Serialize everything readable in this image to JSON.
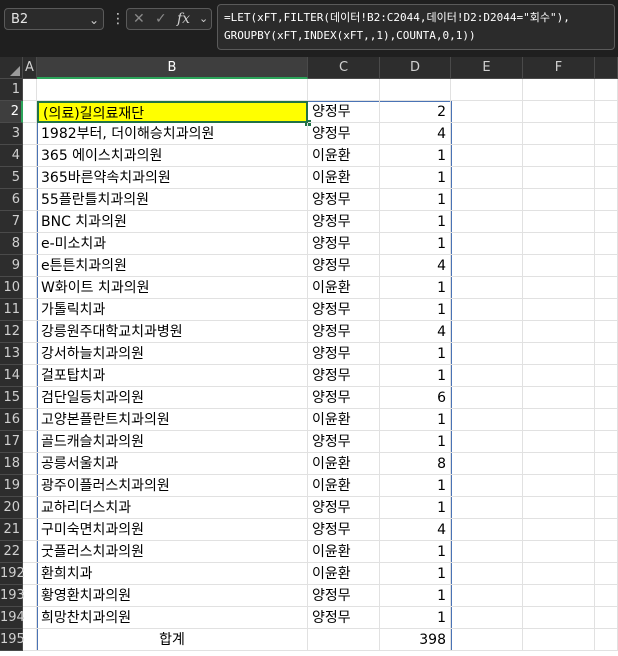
{
  "toolbar": {
    "name_box": "B2",
    "formula_line1": "=LET(xFT,FILTER(데이터!B2:C2044,데이터!D2:D2044=\"회수\"),",
    "formula_line2": "GROUPBY(xFT,INDEX(xFT,,1),COUNTA,0,1))"
  },
  "columns": [
    "A",
    "B",
    "C",
    "D",
    "E",
    "F"
  ],
  "rows": [
    {
      "num": "1",
      "b": "",
      "c": "",
      "d": ""
    },
    {
      "num": "2",
      "b": "(의료)길의료재단",
      "c": "양정무",
      "d": "2"
    },
    {
      "num": "3",
      "b": "1982부터, 더이해승치과의원",
      "c": "양정무",
      "d": "4"
    },
    {
      "num": "4",
      "b": "365 에이스치과의원",
      "c": "이윤환",
      "d": "1"
    },
    {
      "num": "5",
      "b": "365바른약속치과의원",
      "c": "이윤환",
      "d": "1"
    },
    {
      "num": "6",
      "b": "55플란틀치과의원",
      "c": "양정무",
      "d": "1"
    },
    {
      "num": "7",
      "b": "BNC 치과의원",
      "c": "양정무",
      "d": "1"
    },
    {
      "num": "8",
      "b": "e-미소치과",
      "c": "양정무",
      "d": "1"
    },
    {
      "num": "9",
      "b": "e튼튼치과의원",
      "c": "양정무",
      "d": "4"
    },
    {
      "num": "10",
      "b": "W화이트 치과의원",
      "c": "이윤환",
      "d": "1"
    },
    {
      "num": "11",
      "b": "가톨릭치과",
      "c": "양정무",
      "d": "1"
    },
    {
      "num": "12",
      "b": "강릉원주대학교치과병원",
      "c": "양정무",
      "d": "4"
    },
    {
      "num": "13",
      "b": "강서하늘치과의원",
      "c": "양정무",
      "d": "1"
    },
    {
      "num": "14",
      "b": "걸포탑치과",
      "c": "양정무",
      "d": "1"
    },
    {
      "num": "15",
      "b": "검단일등치과의원",
      "c": "양정무",
      "d": "6"
    },
    {
      "num": "16",
      "b": "고양본플란트치과의원",
      "c": "이윤환",
      "d": "1"
    },
    {
      "num": "17",
      "b": "골드캐슬치과의원",
      "c": "양정무",
      "d": "1"
    },
    {
      "num": "18",
      "b": "공릉서울치과",
      "c": "이윤환",
      "d": "8"
    },
    {
      "num": "19",
      "b": "광주이플러스치과의원",
      "c": "이윤환",
      "d": "1"
    },
    {
      "num": "20",
      "b": "교하리더스치과",
      "c": "양정무",
      "d": "1"
    },
    {
      "num": "21",
      "b": "구미숙면치과의원",
      "c": "양정무",
      "d": "4"
    },
    {
      "num": "22",
      "b": "굿플러스치과의원",
      "c": "이윤환",
      "d": "1"
    },
    {
      "num": "192",
      "b": "환희치과",
      "c": "이윤환",
      "d": "1"
    },
    {
      "num": "193",
      "b": "황영환치과의원",
      "c": "양정무",
      "d": "1"
    },
    {
      "num": "194",
      "b": "희망찬치과의원",
      "c": "양정무",
      "d": "1"
    },
    {
      "num": "195",
      "b": "합계",
      "c": "",
      "d": "398"
    }
  ],
  "colors": {
    "selected_fill": "#ffff00",
    "selection_green": "#217346",
    "spill_border": "#4a73b5"
  }
}
